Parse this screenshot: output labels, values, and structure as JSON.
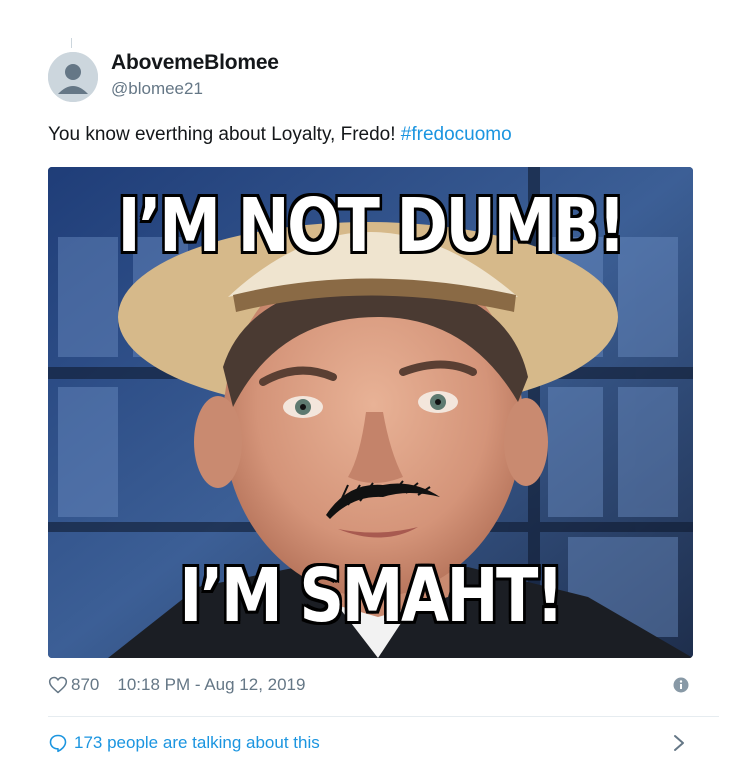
{
  "user": {
    "display_name": "AbovemeBlomee",
    "handle": "@blomee21"
  },
  "tweet": {
    "text": "You know everthing about Loyalty, Fredo! ",
    "hashtag": "#fredocuomo"
  },
  "media": {
    "top_caption": "I’M NOT DUMB!",
    "bottom_caption": "I’M SMAHT!"
  },
  "meta": {
    "likes": "870",
    "timestamp": "10:18 PM - Aug 12, 2019"
  },
  "footer": {
    "talking_text": "173 people are talking about this"
  },
  "icons": {
    "heart": "heart-icon",
    "info": "info-icon",
    "reply": "speech-bubble-icon",
    "chevron": "chevron-right-icon"
  },
  "colors": {
    "link": "#1b95e0",
    "secondary_text": "#657786",
    "primary_text": "#14171a",
    "divider": "#e6ecf0"
  }
}
